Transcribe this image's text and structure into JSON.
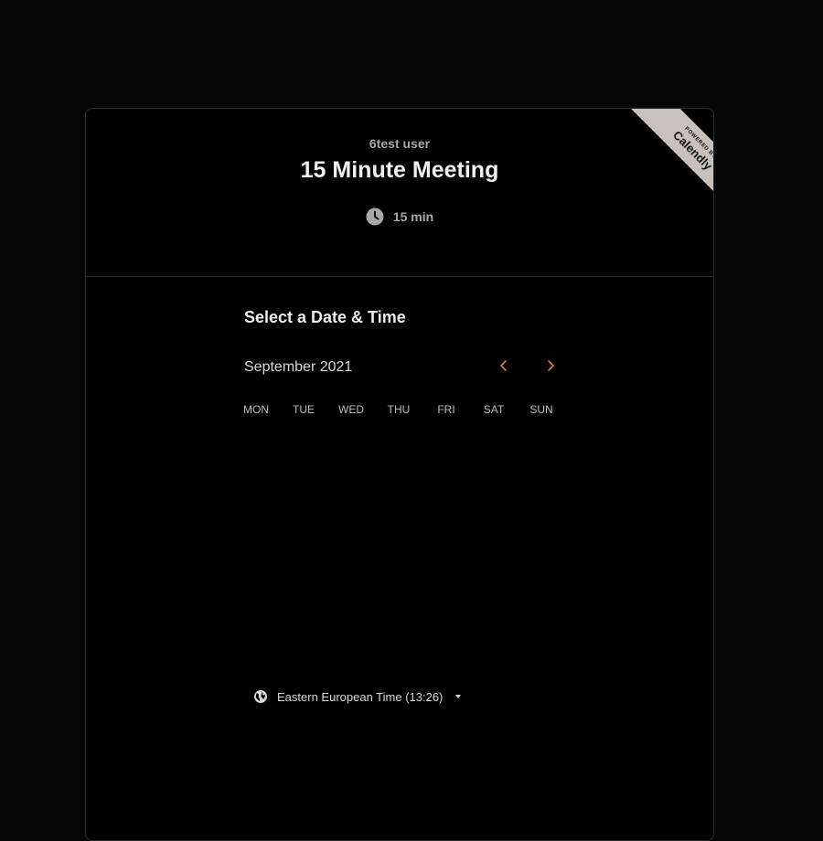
{
  "header": {
    "owner_name": "6test user",
    "event_title": "15 Minute Meeting",
    "duration": "15 min",
    "duration_icon": "clock-icon"
  },
  "badge": {
    "powered_by": "POWERED BY",
    "brand": "Calendly",
    "color": "#c9c2bc"
  },
  "scheduler": {
    "section_title": "Select a Date & Time",
    "month": "September 2021",
    "prev_icon": "chevron-left-icon",
    "next_icon": "chevron-right-icon",
    "weekdays": [
      "MON",
      "TUE",
      "WED",
      "THU",
      "FRI",
      "SAT",
      "SUN"
    ]
  },
  "timezone": {
    "label": "Eastern European Time (13:26)",
    "icon": "globe-icon"
  },
  "colors": {
    "accent": "#e0803a",
    "background": "#000000",
    "text": "#ececec",
    "muted": "#a8a8a8"
  }
}
